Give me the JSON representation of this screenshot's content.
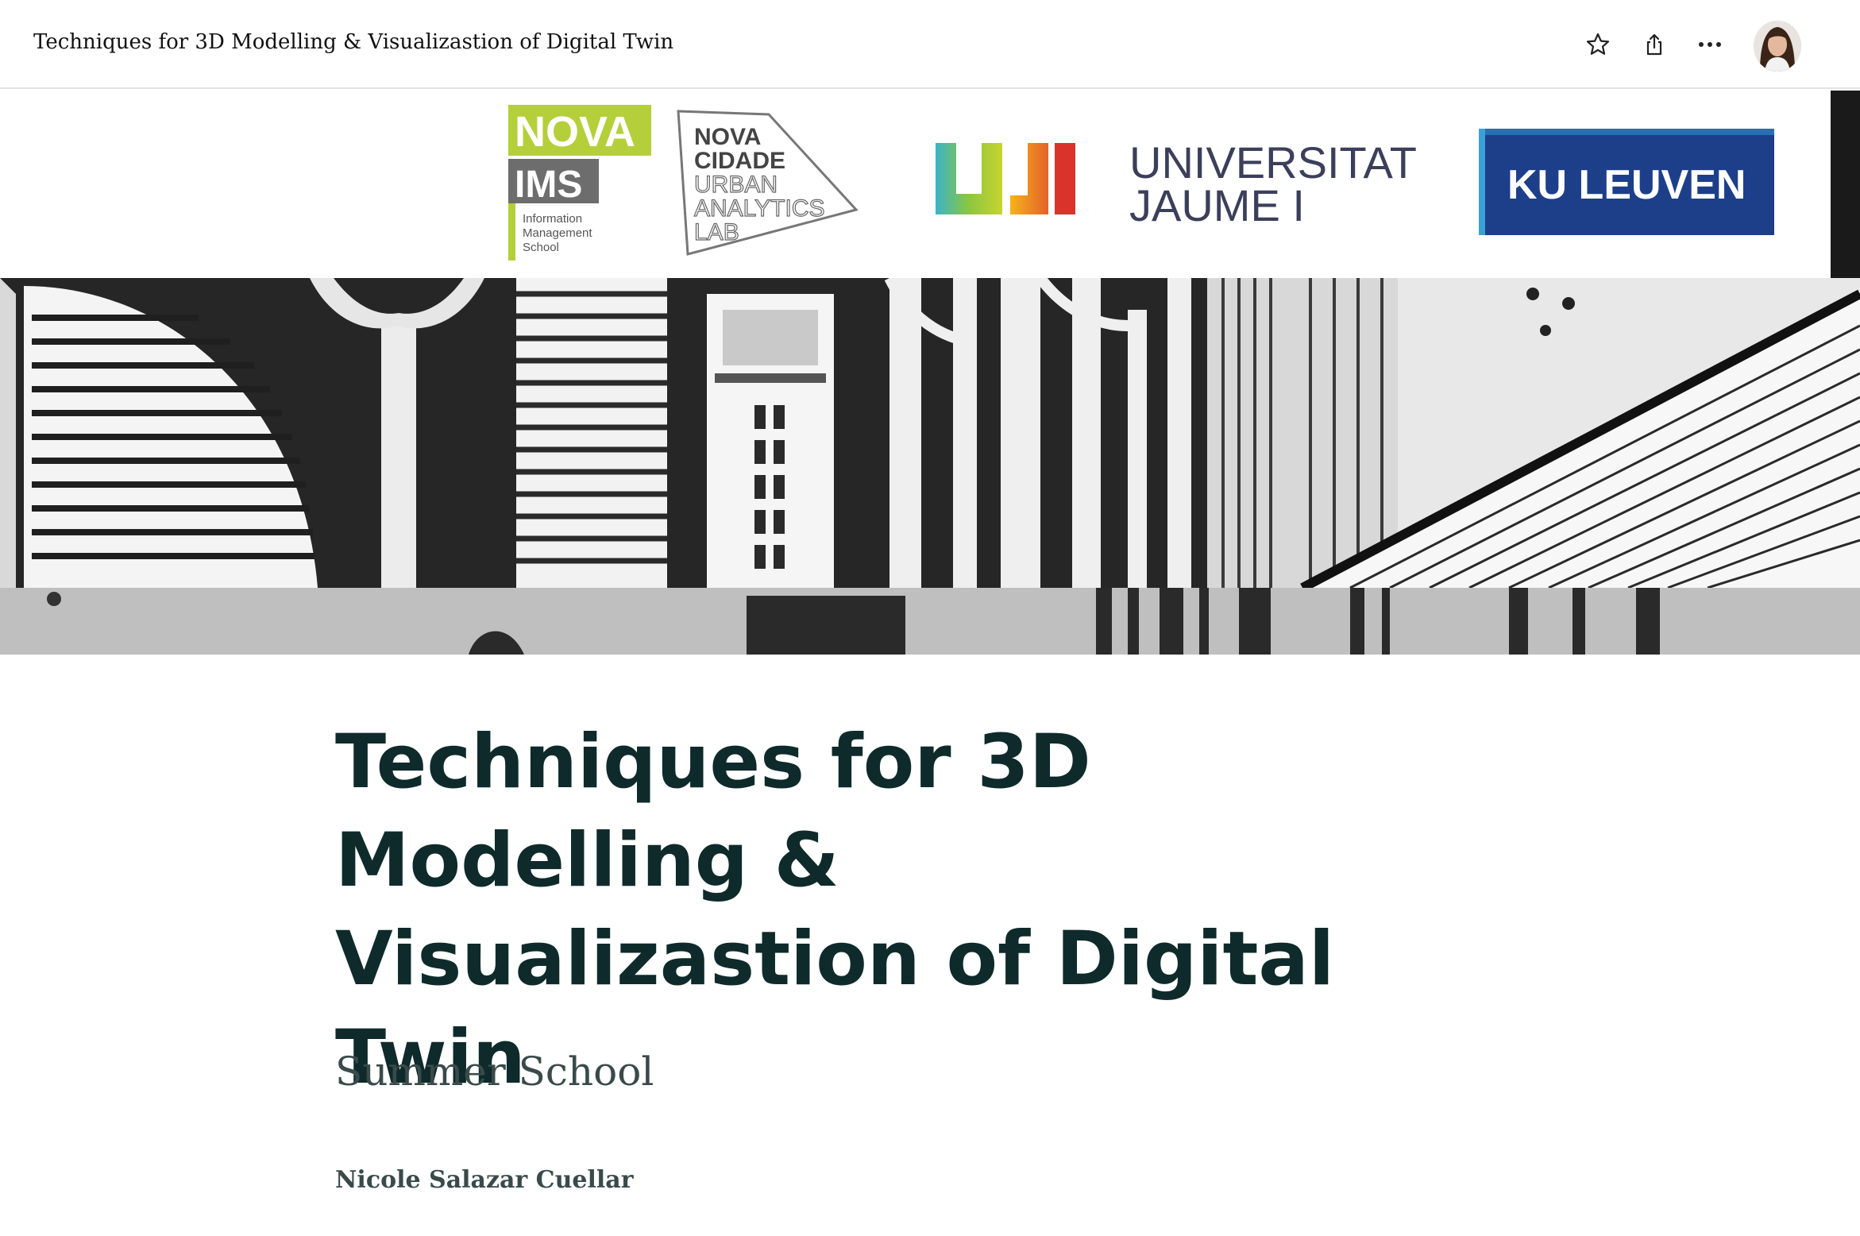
{
  "header": {
    "doc_title": "Techniques for 3D Modelling & Visualizastion of Digital Twin",
    "favorite_icon": "star-icon",
    "share_icon": "share-icon",
    "more_icon": "more-horizontal-icon"
  },
  "banner": {
    "logos": {
      "nova_ims": {
        "line1": "NOVA",
        "line2": "IMS",
        "line3": "Information",
        "line4": "Management",
        "line5": "School"
      },
      "nova_cidade": {
        "line1": "NOVA",
        "line2": "CIDADE",
        "line3": "URBAN",
        "line4": "ANALYTICS",
        "line5": "LAB"
      },
      "uji": {
        "line1": "UNIVERSITAT",
        "line2": "JAUME I"
      },
      "ku_leuven": {
        "text": "KU LEUVEN"
      }
    },
    "colors": {
      "nova_green": "#b5cf3a",
      "nova_grey": "#6b6b6b",
      "ku_blue": "#1d3f8a"
    }
  },
  "page": {
    "title": "Techniques for 3D Modelling & Visualizastion of Digital Twin",
    "subtitle": "Summer School",
    "author": "Nicole Salazar Cuellar"
  }
}
